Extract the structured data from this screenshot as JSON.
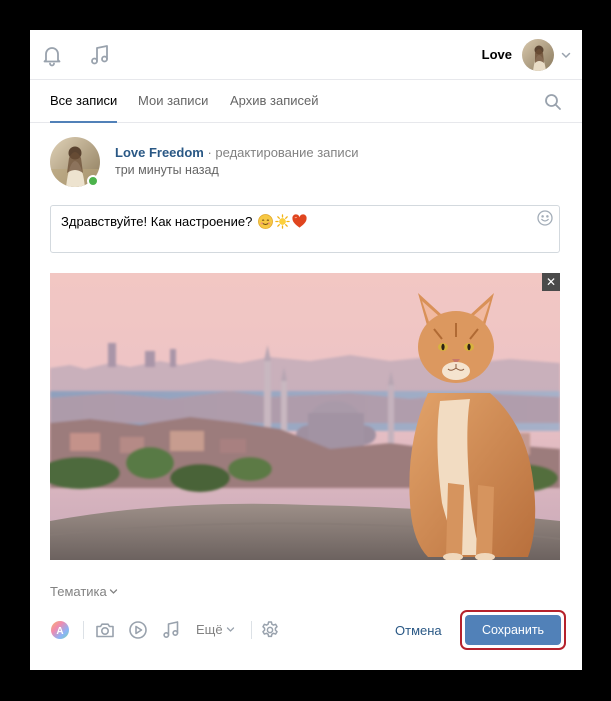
{
  "header": {
    "username": "Love",
    "icons": [
      "bell-icon",
      "music-icon",
      "chevron-down-icon"
    ]
  },
  "tabs": [
    {
      "label": "Все записи",
      "active": true
    },
    {
      "label": "Мои записи",
      "active": false
    },
    {
      "label": "Архив записей",
      "active": false
    }
  ],
  "post": {
    "author": "Love Freedom",
    "action": "· редактирование записи",
    "time": "три минуты назад",
    "text": "Здравствуйте! Как настроение?",
    "emojis": [
      "smiling-face-emoji",
      "sun-emoji",
      "heart-emoji"
    ],
    "remove_label": "✕"
  },
  "footer": {
    "topic_label": "Тематика",
    "more_label": "Ещё",
    "cancel_label": "Отмена",
    "save_label": "Сохранить"
  },
  "colors": {
    "accent": "#5181b8",
    "link": "#2a5885",
    "highlight": "#b5222c",
    "online": "#4bb34b"
  }
}
